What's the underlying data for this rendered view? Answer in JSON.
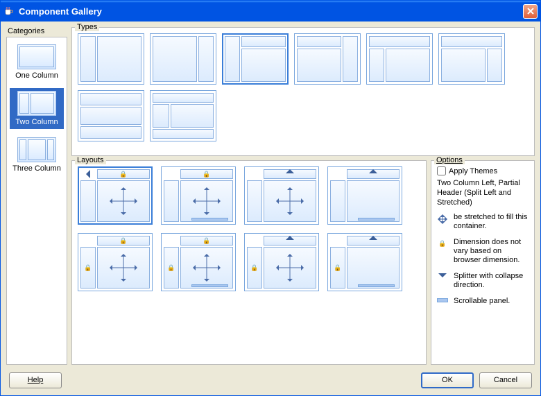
{
  "window": {
    "title": "Component Gallery"
  },
  "categories": {
    "label": "Categories",
    "items": [
      {
        "label": "One Column"
      },
      {
        "label": "Two Column"
      },
      {
        "label": "Three Column"
      }
    ],
    "selected_index": 1
  },
  "types": {
    "label": "Types",
    "selected_index": 2,
    "count": 8
  },
  "layouts": {
    "label": "Layouts",
    "selected_index": 0,
    "count": 8
  },
  "options": {
    "label": "Options",
    "apply_themes_label": "Apply Themes",
    "apply_themes_checked": false,
    "description": "Two Column Left, Partial Header (Split Left and Stretched)",
    "legend": [
      {
        "icon": "stretch",
        "text": "be stretched to fill this container."
      },
      {
        "icon": "lock",
        "text": "Dimension does not vary based on browser dimension."
      },
      {
        "icon": "splitter",
        "text": "Splitter with collapse direction."
      },
      {
        "icon": "scroll",
        "text": "Scrollable panel."
      }
    ]
  },
  "footer": {
    "help": "Help",
    "ok": "OK",
    "cancel": "Cancel"
  }
}
